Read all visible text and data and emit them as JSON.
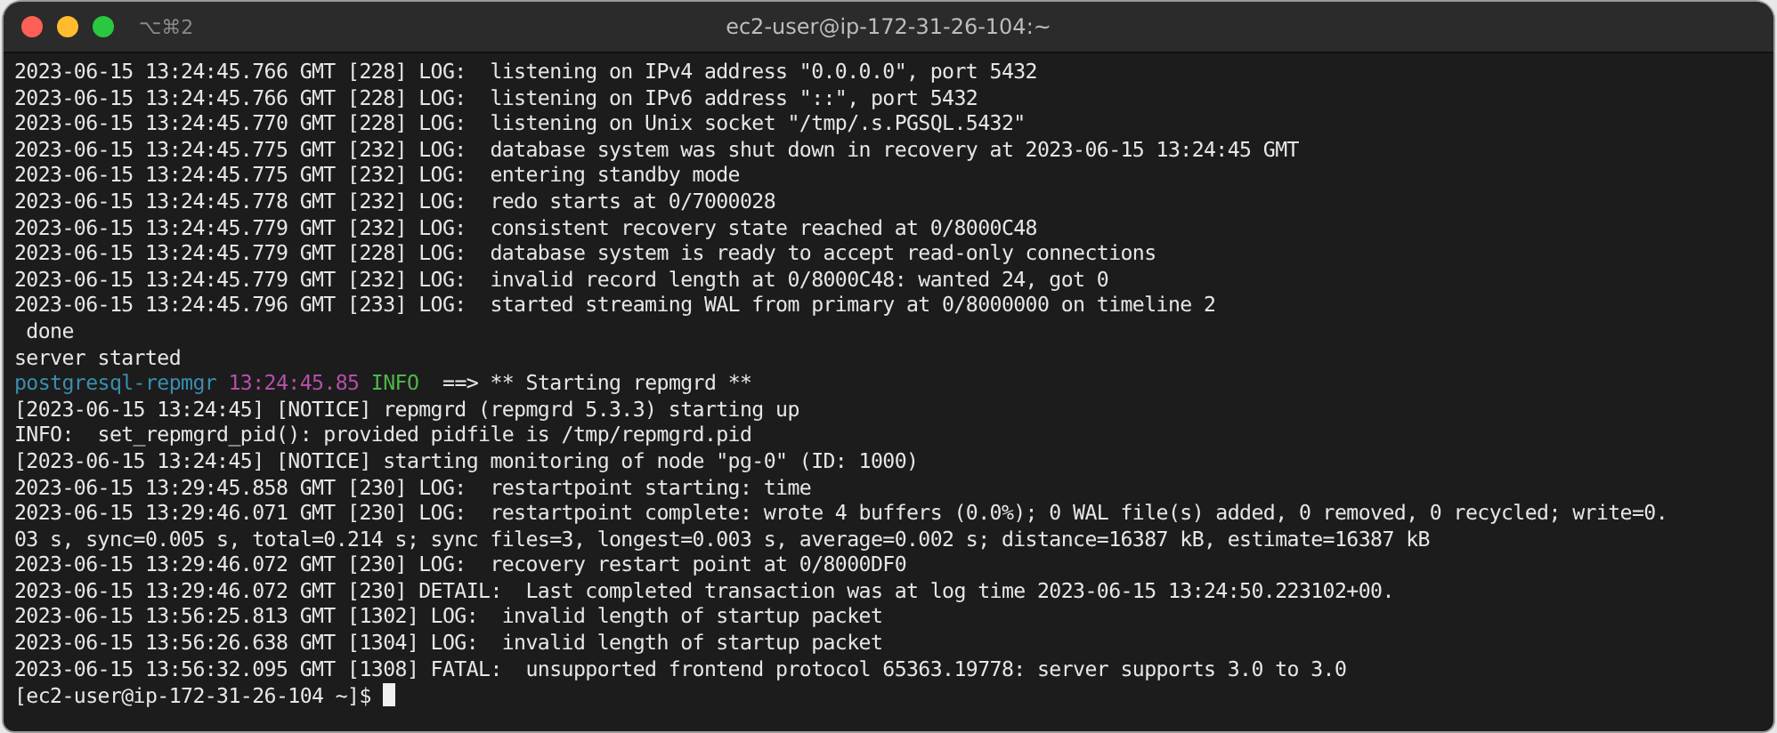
{
  "window": {
    "title": "ec2-user@ip-172-31-26-104:~",
    "shortcut": "⌥⌘2"
  },
  "lines": [
    {
      "text": "2023-06-15 13:24:45.766 GMT [228] LOG:  listening on IPv4 address \"0.0.0.0\", port 5432"
    },
    {
      "text": "2023-06-15 13:24:45.766 GMT [228] LOG:  listening on IPv6 address \"::\", port 5432"
    },
    {
      "text": "2023-06-15 13:24:45.770 GMT [228] LOG:  listening on Unix socket \"/tmp/.s.PGSQL.5432\""
    },
    {
      "text": "2023-06-15 13:24:45.775 GMT [232] LOG:  database system was shut down in recovery at 2023-06-15 13:24:45 GMT"
    },
    {
      "text": "2023-06-15 13:24:45.775 GMT [232] LOG:  entering standby mode"
    },
    {
      "text": "2023-06-15 13:24:45.778 GMT [232] LOG:  redo starts at 0/7000028"
    },
    {
      "text": "2023-06-15 13:24:45.779 GMT [232] LOG:  consistent recovery state reached at 0/8000C48"
    },
    {
      "text": "2023-06-15 13:24:45.779 GMT [228] LOG:  database system is ready to accept read-only connections"
    },
    {
      "text": "2023-06-15 13:24:45.779 GMT [232] LOG:  invalid record length at 0/8000C48: wanted 24, got 0"
    },
    {
      "text": "2023-06-15 13:24:45.796 GMT [233] LOG:  started streaming WAL from primary at 0/8000000 on timeline 2"
    },
    {
      "text": " done"
    },
    {
      "text": "server started"
    },
    {
      "segments": [
        {
          "text": "postgresql-repmgr",
          "color": "#3a8fb0"
        },
        {
          "text": "13:24:45.85",
          "color": "#b54fa8"
        },
        {
          "text": "INFO",
          "color": "#4fb548"
        },
        {
          "text": " ==> ** Starting repmgrd **",
          "color": "#e6e6e6"
        }
      ]
    },
    {
      "text": "[2023-06-15 13:24:45] [NOTICE] repmgrd (repmgrd 5.3.3) starting up"
    },
    {
      "text": "INFO:  set_repmgrd_pid(): provided pidfile is /tmp/repmgrd.pid"
    },
    {
      "text": "[2023-06-15 13:24:45] [NOTICE] starting monitoring of node \"pg-0\" (ID: 1000)"
    },
    {
      "text": "2023-06-15 13:29:45.858 GMT [230] LOG:  restartpoint starting: time"
    },
    {
      "text": "2023-06-15 13:29:46.071 GMT [230] LOG:  restartpoint complete: wrote 4 buffers (0.0%); 0 WAL file(s) added, 0 removed, 0 recycled; write=0."
    },
    {
      "text": "03 s, sync=0.005 s, total=0.214 s; sync files=3, longest=0.003 s, average=0.002 s; distance=16387 kB, estimate=16387 kB"
    },
    {
      "text": "2023-06-15 13:29:46.072 GMT [230] LOG:  recovery restart point at 0/8000DF0"
    },
    {
      "text": "2023-06-15 13:29:46.072 GMT [230] DETAIL:  Last completed transaction was at log time 2023-06-15 13:24:50.223102+00."
    },
    {
      "text": "2023-06-15 13:56:25.813 GMT [1302] LOG:  invalid length of startup packet"
    },
    {
      "text": "2023-06-15 13:56:26.638 GMT [1304] LOG:  invalid length of startup packet"
    },
    {
      "text": "2023-06-15 13:56:32.095 GMT [1308] FATAL:  unsupported frontend protocol 65363.19778: server supports 3.0 to 3.0"
    }
  ],
  "prompt": {
    "text": "[ec2-user@ip-172-31-26-104 ~]$",
    "cursor": true
  }
}
